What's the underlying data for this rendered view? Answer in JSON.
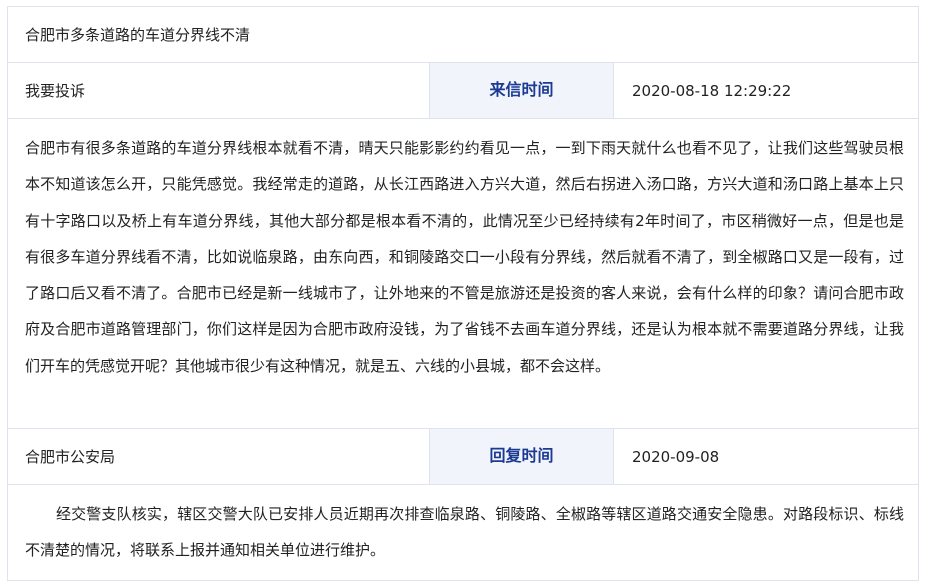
{
  "title": "合肥市多条道路的车道分界线不清",
  "complaint": {
    "left_label": "我要投诉",
    "time_label": "来信时间",
    "time_value": "2020-08-18 12:29:22",
    "content": "合肥市有很多条道路的车道分界线根本就看不清，晴天只能影影约约看见一点，一到下雨天就什么也看不见了，让我们这些驾驶员根本不知道该怎么开，只能凭感觉。我经常走的道路，从长江西路进入方兴大道，然后右拐进入汤口路，方兴大道和汤口路上基本上只有十字路口以及桥上有车道分界线，其他大部分都是根本看不清的，此情况至少已经持续有2年时间了，市区稍微好一点，但是也是有很多车道分界线看不清，比如说临泉路，由东向西，和铜陵路交口一小段有分界线，然后就看不清了，到全椒路口又是一段有，过了路口后又看不清了。合肥市已经是新一线城市了，让外地来的不管是旅游还是投资的客人来说，会有什么样的印象？请问合肥市政府及合肥市道路管理部门，你们这样是因为合肥市政府没钱，为了省钱不去画车道分界线，还是认为根本就不需要道路分界线，让我们开车的凭感觉开呢？其他城市很少有这种情况，就是五、六线的小县城，都不会这样。"
  },
  "reply": {
    "department": "合肥市公安局",
    "time_label": "回复时间",
    "time_value": "2020-09-08",
    "content": "经交警支队核实，辖区交警大队已安排人员近期再次排查临泉路、铜陵路、全椒路等辖区道路交通安全隐患。对路段标识、标线不清楚的情况，将联系上报并通知相关单位进行维护。"
  },
  "colors": {
    "border": "#dfe3ee",
    "label_bg": "#f2f4fb",
    "label_text": "#1b3a93",
    "text": "#222222"
  }
}
